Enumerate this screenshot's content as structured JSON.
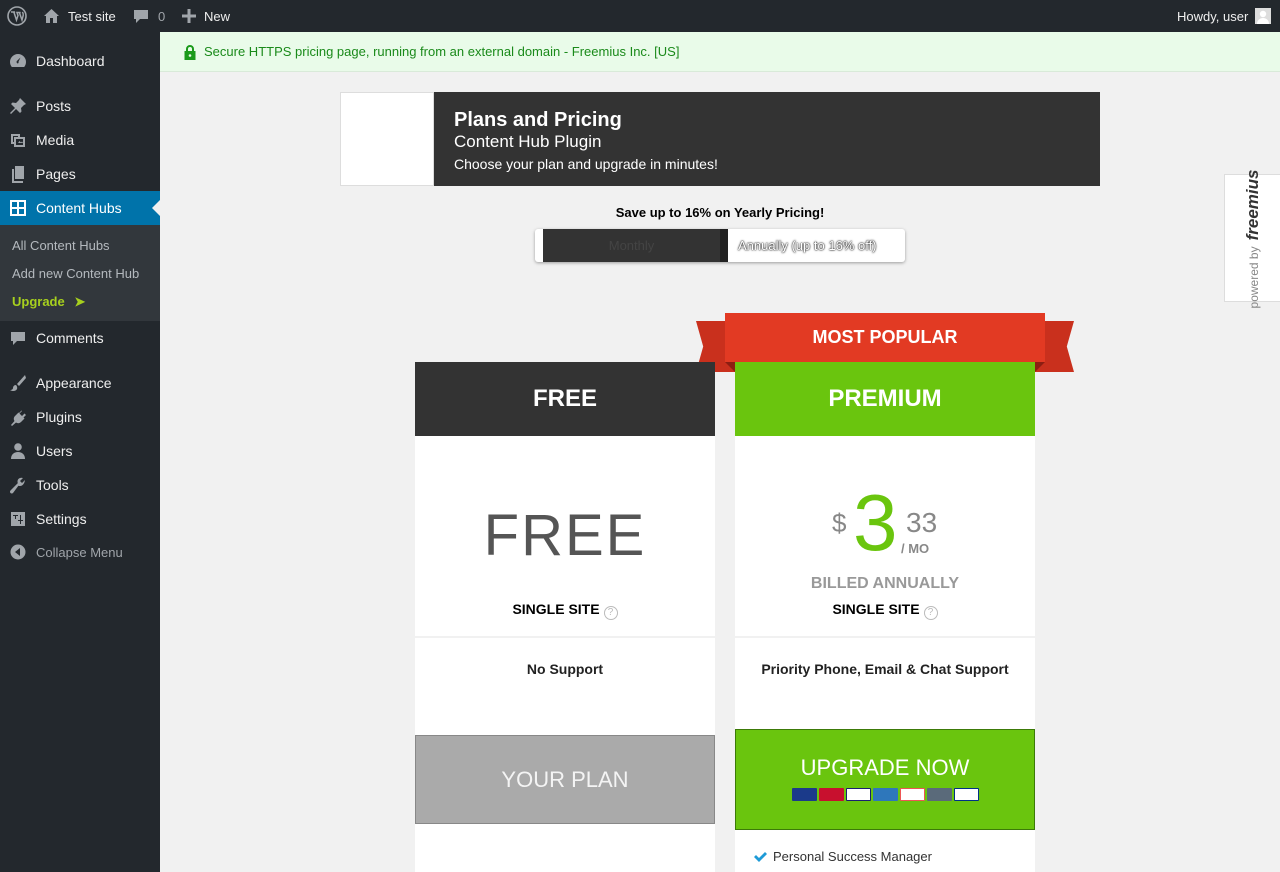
{
  "adminbar": {
    "site_name": "Test site",
    "comment_count": "0",
    "new_label": "New",
    "greeting": "Howdy, user"
  },
  "sidebar": {
    "items": [
      {
        "label": "Dashboard",
        "icon": "dashboard-icon"
      },
      {
        "label": "Posts",
        "icon": "pin-icon"
      },
      {
        "label": "Media",
        "icon": "media-icon"
      },
      {
        "label": "Pages",
        "icon": "pages-icon"
      },
      {
        "label": "Content Hubs",
        "icon": "grid-icon"
      },
      {
        "label": "Comments",
        "icon": "comment-icon"
      },
      {
        "label": "Appearance",
        "icon": "brush-icon"
      },
      {
        "label": "Plugins",
        "icon": "plug-icon"
      },
      {
        "label": "Users",
        "icon": "user-icon"
      },
      {
        "label": "Tools",
        "icon": "wrench-icon"
      },
      {
        "label": "Settings",
        "icon": "sliders-icon"
      },
      {
        "label": "Collapse Menu",
        "icon": "collapse-icon"
      }
    ],
    "submenu": {
      "all": "All Content Hubs",
      "add": "Add new Content Hub",
      "upgrade": "Upgrade",
      "upgrade_arrow": "➤"
    }
  },
  "notice": {
    "text": "Secure HTTPS pricing page, running from an external domain - Freemius Inc. [US]"
  },
  "header": {
    "title": "Plans and Pricing",
    "subtitle": "Content Hub Plugin",
    "tagline": "Choose your plan and upgrade in minutes!"
  },
  "billing": {
    "promo": "Save up to 16% on Yearly Pricing!",
    "monthly": "Monthly",
    "annual": "Annually (up to 16% off)"
  },
  "powered": {
    "prefix": "powered by",
    "brand": "freemius"
  },
  "plans": {
    "free": {
      "name": "FREE",
      "price_text": "FREE",
      "sites": "SINGLE SITE",
      "support": "No Support",
      "button": "YOUR PLAN"
    },
    "premium": {
      "ribbon": "MOST POPULAR",
      "name": "PREMIUM",
      "currency": "$",
      "price_int": "3",
      "price_dec": "33",
      "period": "/ MO",
      "billing": "BILLED ANNUALLY",
      "sites": "SINGLE SITE",
      "support": "Priority Phone, Email & Chat Support",
      "button": "UPGRADE NOW",
      "feature": "Personal Success Manager",
      "cards": [
        "Maestro",
        "MasterCard",
        "VISA",
        "Amex",
        "DISCOVER",
        "BANK",
        "PayPal"
      ]
    }
  },
  "colors": {
    "wp_dark": "#23282d",
    "wp_blue": "#0073aa",
    "premium_green": "#6ac50e",
    "ribbon_red": "#e23a23",
    "free_gray": "#333333"
  }
}
